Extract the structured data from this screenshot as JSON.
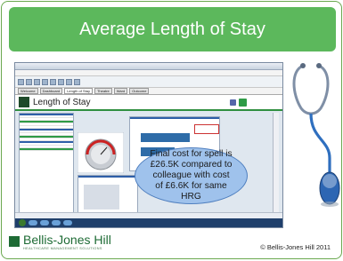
{
  "slide": {
    "title": "Average Length of Stay",
    "callout_text": "Final cost for spell is £26.5K compared to colleague with cost of £6.6K for same HRG",
    "copyright": "© Bellis-Jones Hill 2011",
    "brand": {
      "name": "Bellis-Jones Hill",
      "subtitle": "HEALTHCARE MANAGEMENT SOLUTIONS"
    },
    "colors": {
      "title_bar": "#5cb85c",
      "callout": "#9fc2ec",
      "brand_green": "#1e6b35"
    }
  },
  "screenshot": {
    "page_title": "Length of Stay",
    "tabs": [
      "Welcome",
      "Dashboard",
      "Length of Stay",
      "Theatre",
      "Ward",
      "Outcome"
    ]
  }
}
